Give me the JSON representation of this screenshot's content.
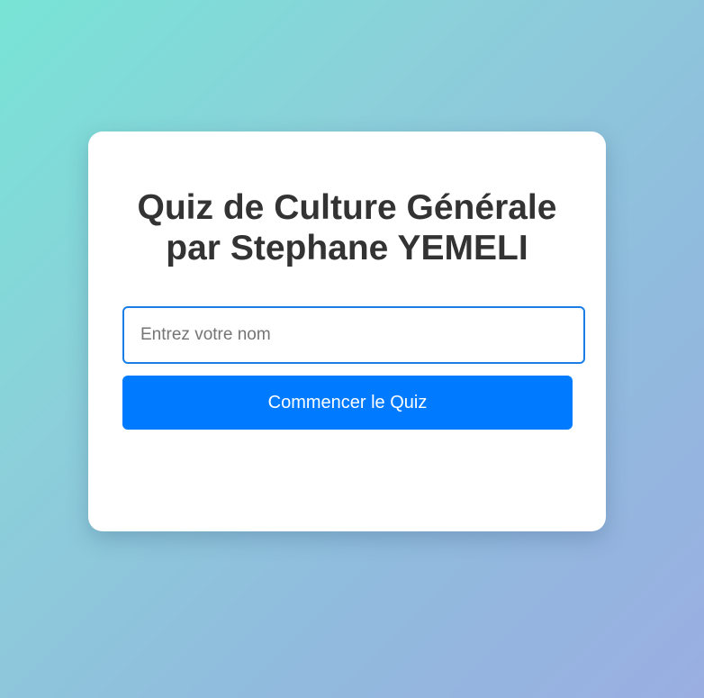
{
  "quiz": {
    "title_line1": "Quiz de Culture Générale",
    "title_line2": "par Stephane YEMELI",
    "name_input": {
      "placeholder": "Entrez votre nom",
      "value": ""
    },
    "start_button_label": "Commencer le Quiz"
  },
  "colors": {
    "accent": "#007bff",
    "input_border": "#1a7ee6",
    "title_text": "#333333",
    "card_background": "#ffffff",
    "background_gradient": [
      "#78e4d6",
      "#9aaee2"
    ]
  }
}
